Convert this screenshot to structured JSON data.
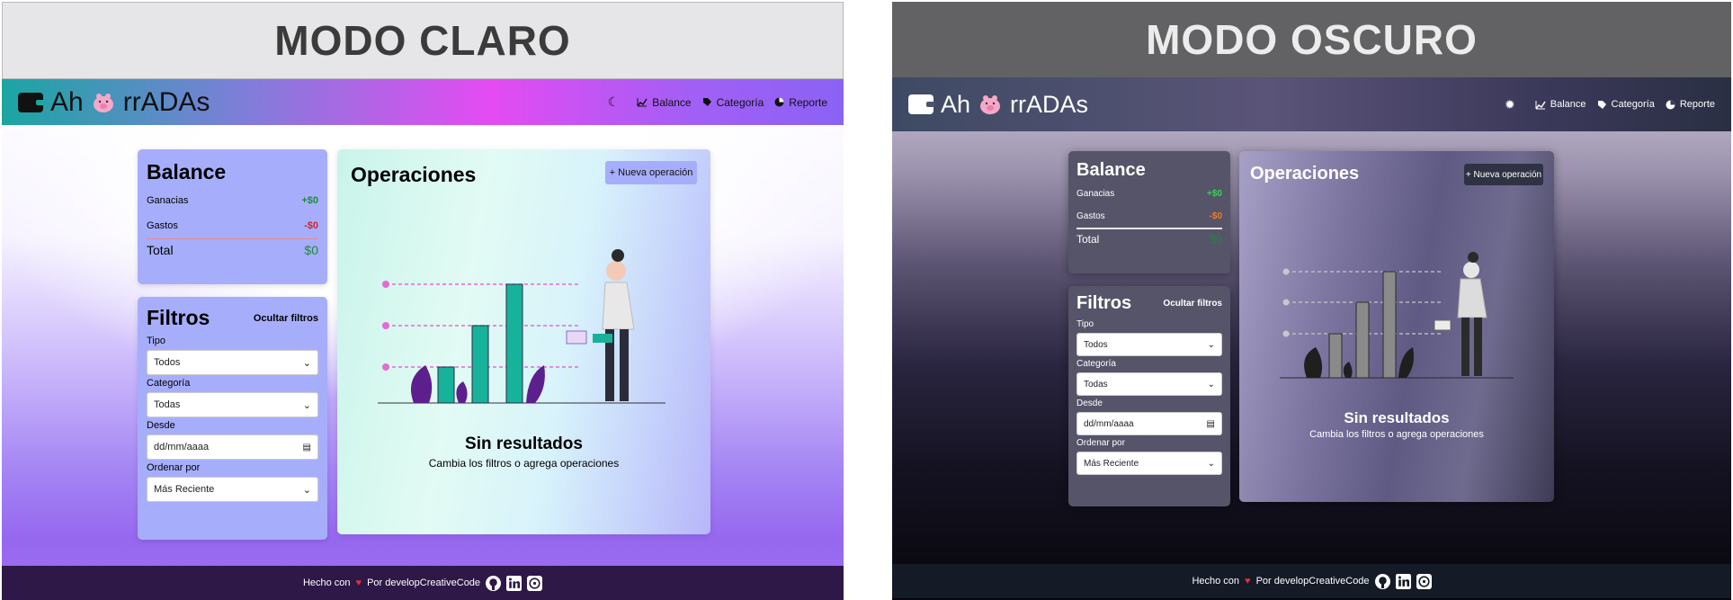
{
  "light": {
    "banner": "MODO CLARO",
    "nav": {
      "brand_left": "Ah",
      "brand_right": "rrADAs",
      "links": [
        "Balance",
        "Categoría",
        "Reporte"
      ]
    },
    "balance": {
      "title": "Balance",
      "ganancias_label": "Ganacias",
      "ganancias_value": "+$0",
      "gastos_label": "Gastos",
      "gastos_value": "-$0",
      "total_label": "Total",
      "total_value": "$0"
    },
    "filters": {
      "title": "Filtros",
      "toggle": "Ocultar filtros",
      "tipo_label": "Tipo",
      "tipo_value": "Todos",
      "categoria_label": "Categoría",
      "categoria_value": "Todas",
      "desde_label": "Desde",
      "desde_value": "dd/mm/aaaa",
      "orden_label": "Ordenar por",
      "orden_value": "Más Reciente"
    },
    "operations": {
      "title": "Operaciones",
      "new_button": "+ Nueva operación",
      "empty_title": "Sin resultados",
      "empty_subtitle": "Cambia los filtros o agrega operaciones"
    },
    "footer": {
      "made_with": "Hecho con",
      "by": "Por developCreativeCode"
    }
  },
  "dark": {
    "banner": "MODO OSCURO",
    "nav": {
      "brand_left": "Ah",
      "brand_right": "rrADAs",
      "links": [
        "Balance",
        "Categoría",
        "Reporte"
      ]
    },
    "balance": {
      "title": "Balance",
      "ganancias_label": "Ganacias",
      "ganancias_value": "+$0",
      "gastos_label": "Gastos",
      "gastos_value": "-$0",
      "total_label": "Total",
      "total_value": "$0"
    },
    "filters": {
      "title": "Filtros",
      "toggle": "Ocultar filtros",
      "tipo_label": "Tipo",
      "tipo_value": "Todos",
      "categoria_label": "Categoría",
      "categoria_value": "Todas",
      "desde_label": "Desde",
      "desde_value": "dd/mm/aaaa",
      "orden_label": "Ordenar por",
      "orden_value": "Más Reciente"
    },
    "operations": {
      "title": "Operaciones",
      "new_button": "+ Nueva operación",
      "empty_title": "Sin resultados",
      "empty_subtitle": "Cambia los filtros o agrega operaciones"
    },
    "footer": {
      "made_with": "Hecho con",
      "by": "Por developCreativeCode"
    }
  },
  "icons": {
    "theme_light": "moon-icon",
    "theme_dark": "sun-icon",
    "balance": "chart-line-icon",
    "categoria": "tag-icon",
    "reporte": "pie-chart-icon",
    "footer": [
      "github-icon",
      "linkedin-icon",
      "whatsapp-icon"
    ]
  },
  "colors": {
    "light_accent": "#a6aefc",
    "light_navbar_start": "#1aa6a2",
    "light_navbar_mid": "#e44bf2",
    "dark_navbar": "#3d3a5c",
    "positive": "#1d8a3b",
    "negative": "#d0262b",
    "chart_bar_light": "#16b39a",
    "chart_bar_dark": "#8a8a8a"
  }
}
